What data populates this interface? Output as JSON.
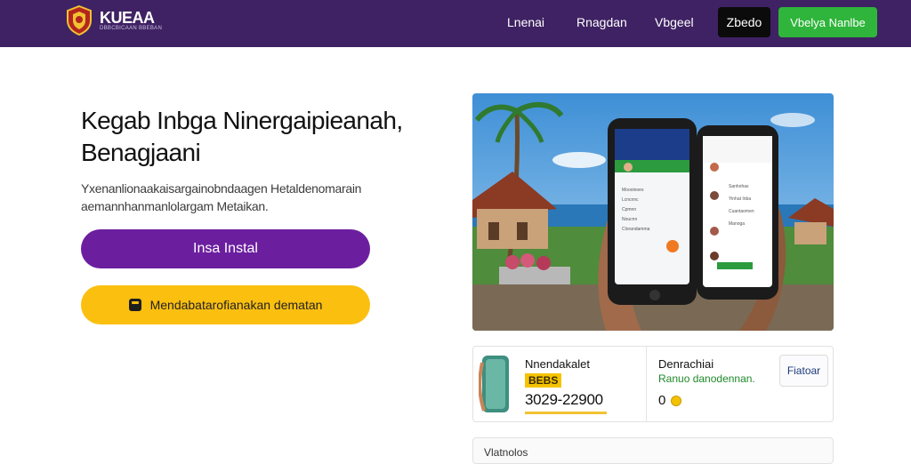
{
  "header": {
    "brand": "KUEAA",
    "brand_sub": "DBBCBICAAN BBEBAN",
    "nav": [
      "Lnenai",
      "Rnagdan",
      "Vbgeel"
    ],
    "btn_dark": "Zbedo",
    "btn_green": "Vbelya Nanlbe"
  },
  "hero": {
    "title": "Kegab Inbga Ninergaipieanah, Benagjaani",
    "description": "Yxenanlionaakaisargainobndaagen Hetaldenomarain aemannhanmanlolargam Metaikan.",
    "install_label": "Insa Instal",
    "secondary_label": "Mendabatarofianakan dematan"
  },
  "phones": {
    "left": {
      "rows": [
        "Moooinoes",
        "Lcncnnc",
        "Cpmnn",
        "Noucnn"
      ],
      "footer": "Clorandamma"
    },
    "right": {
      "rows": [
        "Sanhohas",
        "Yinhat Inba",
        "Cuantaomen",
        "Manoga"
      ]
    }
  },
  "info_card": {
    "product_label": "Nnendakalet",
    "product_badge": "BEBS",
    "product_number": "3029-22900",
    "product_progress": 0.85,
    "status_label": "Denrachiai",
    "status_text": "Ranuo danodennan.",
    "status_count": "0",
    "button_label": "Fiatoar"
  },
  "bottom_card": {
    "label": "Vlatnolos"
  },
  "colors": {
    "header_bg": "#3f2263",
    "accent_purple": "#6b1f9f",
    "accent_yellow": "#fbbf10",
    "accent_green": "#2fb53b"
  }
}
